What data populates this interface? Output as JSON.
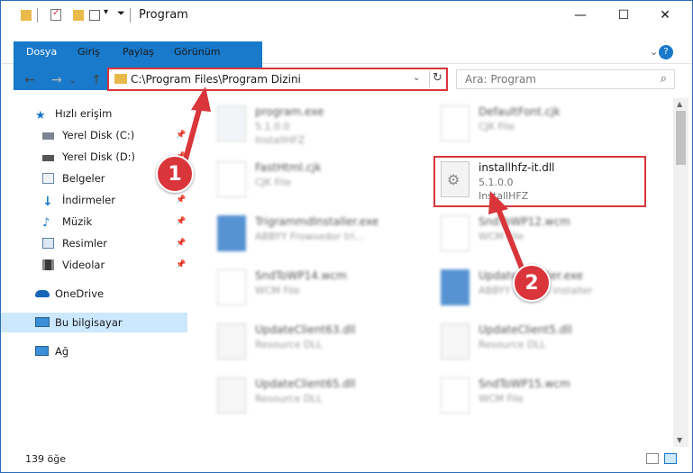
{
  "window": {
    "title": "Program",
    "controls": {
      "minimize": "—",
      "maximize": "☐",
      "close": "✕"
    }
  },
  "ribbon": {
    "tabs": [
      "Dosya",
      "Giriş",
      "Paylaş",
      "Görünüm"
    ],
    "expand": "⌄",
    "help": "?"
  },
  "nav": {
    "back": "←",
    "forward": "→",
    "recent": "⌄",
    "up": "↑",
    "address": "C:\\Program Files\\Program Dizini",
    "address_dropdown": "⌄",
    "refresh": "↻",
    "search_placeholder": "Ara: Program",
    "search_icon": "⌕"
  },
  "sidebar": {
    "items": [
      {
        "label": "Hızlı erişim",
        "icon": "star-icon"
      },
      {
        "label": "Yerel Disk (C:)",
        "icon": "drive-icon",
        "pinned": true
      },
      {
        "label": "Yerel Disk (D:)",
        "icon": "drive-icon",
        "pinned": true
      },
      {
        "label": "Belgeler",
        "icon": "documents-icon",
        "pinned": true
      },
      {
        "label": "İndirmeler",
        "icon": "download-icon",
        "pinned": true
      },
      {
        "label": "Müzik",
        "icon": "music-icon",
        "pinned": true
      },
      {
        "label": "Resimler",
        "icon": "pictures-icon",
        "pinned": true
      },
      {
        "label": "Videolar",
        "icon": "videos-icon",
        "pinned": true
      },
      {
        "label": "OneDrive",
        "icon": "cloud-icon"
      },
      {
        "label": "Bu bilgisayar",
        "icon": "computer-icon",
        "selected": true
      },
      {
        "label": "Ağ",
        "icon": "network-icon"
      }
    ],
    "pin_glyph": "📌"
  },
  "files": [
    {
      "name": "program.exe",
      "line2": "5.1.0.0",
      "line3": "InstallHFZ"
    },
    {
      "name": "DefaultFont.cjk",
      "line2": "CJK File",
      "line3": ""
    },
    {
      "name": "FastHtml.cjk",
      "line2": "CJK File",
      "line3": ""
    },
    {
      "name": "installhfz-it.dll",
      "line2": "5.1.0.0",
      "line3": "InstallHFZ"
    },
    {
      "name": "TrigrammdInstaller.exe",
      "line2": "ABBYY Frowsedor tri...",
      "line3": ""
    },
    {
      "name": "SndToWP12.wcm",
      "line2": "WCM File",
      "line3": ""
    },
    {
      "name": "SndToWP14.wcm",
      "line2": "WCM File",
      "line3": ""
    },
    {
      "name": "UpdateInstaller.exe",
      "line2": "ABBYY Update installer",
      "line3": ""
    },
    {
      "name": "UpdateClient63.dll",
      "line2": "Resource DLL",
      "line3": ""
    },
    {
      "name": "UpdateClient5.dll",
      "line2": "Resource DLL",
      "line3": ""
    },
    {
      "name": "UpdateClient65.dll",
      "line2": "Resource DLL",
      "line3": ""
    },
    {
      "name": "SndToWP15.wcm",
      "line2": "WCM File",
      "line3": ""
    }
  ],
  "status": {
    "count": "139 öğe"
  },
  "callouts": [
    {
      "label": "1"
    },
    {
      "label": "2"
    }
  ],
  "colors": {
    "accent": "#1979ca",
    "highlight": "#d9353b",
    "selection": "#cce8ff"
  }
}
